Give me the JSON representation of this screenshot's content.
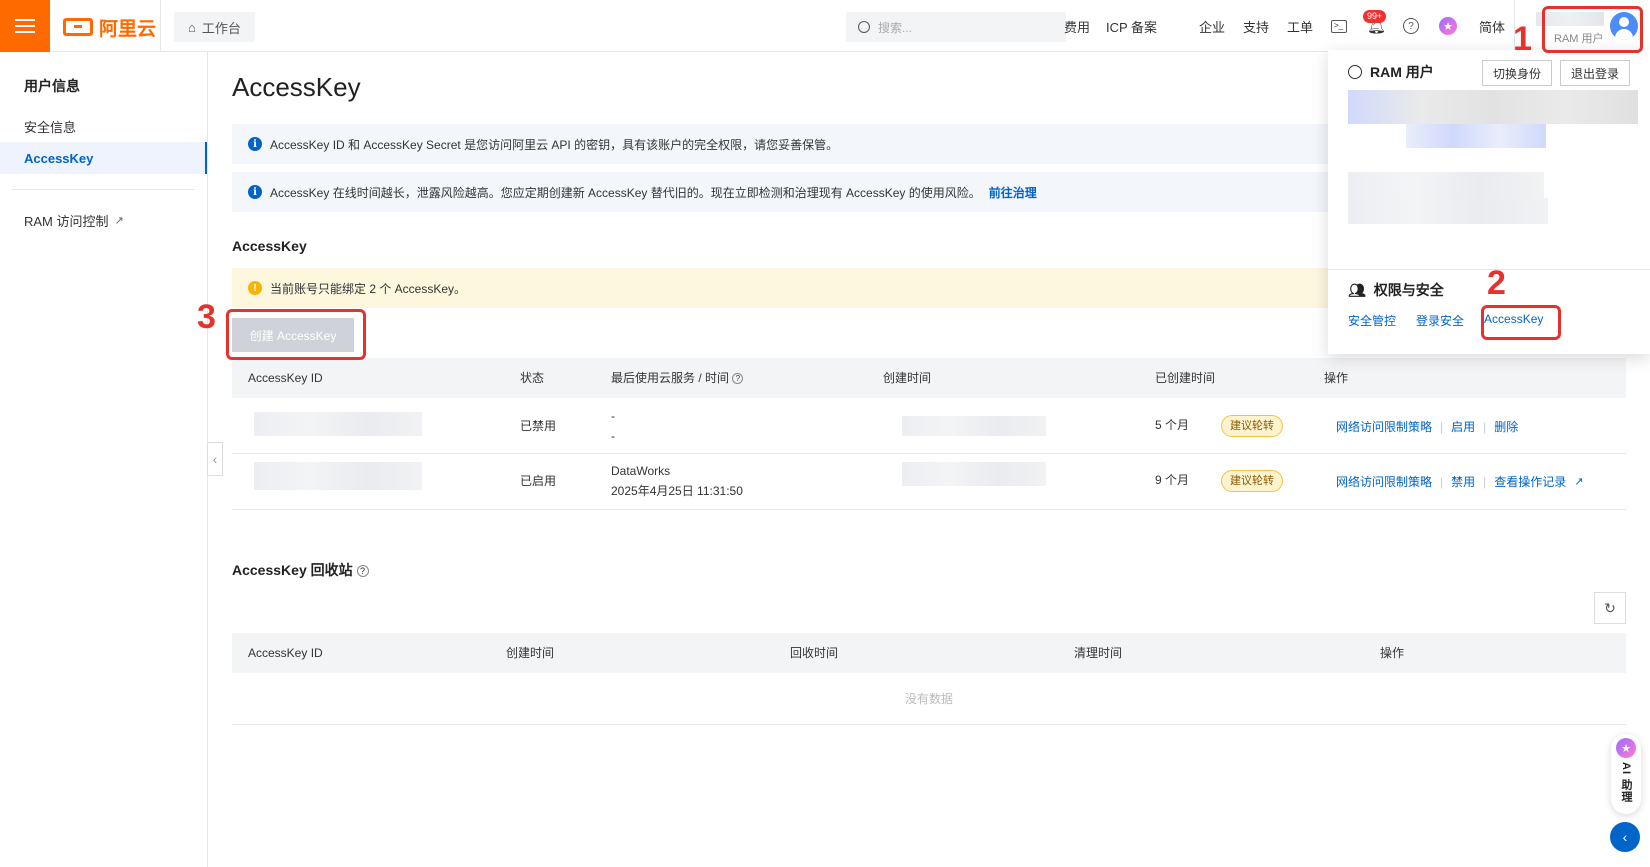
{
  "header": {
    "brand": "阿里云",
    "workbench": "工作台",
    "search_placeholder": "搜索...",
    "nav": [
      "费用",
      "ICP 备案",
      "企业",
      "支持",
      "工单"
    ],
    "notify_badge": "99+",
    "lang": "简体",
    "user_role": "RAM 用户"
  },
  "sidebar": {
    "title": "用户信息",
    "items": [
      {
        "label": "安全信息"
      },
      {
        "label": "AccessKey"
      },
      {
        "label": "RAM 访问控制"
      }
    ]
  },
  "main": {
    "title": "AccessKey",
    "notice1": "AccessKey ID 和 AccessKey Secret 是您访问阿里云 API 的密钥，具有该账户的完全权限，请您妥善保管。",
    "notice2": "AccessKey 在线时间越长，泄露风险越高。您应定期创建新 AccessKey 替代旧的。现在立即检测和治理现有 AccessKey 的使用风险。",
    "notice2_link": "前往治理",
    "section1": "AccessKey",
    "warning": "当前账号只能绑定 2 个 AccessKey。",
    "create_button": "创建 AccessKey",
    "table": {
      "columns": [
        "AccessKey ID",
        "状态",
        "最后使用云服务 / 时间",
        "创建时间",
        "已创建时间",
        "操作"
      ],
      "rows": [
        {
          "status": "已禁用",
          "service": "-",
          "time": "-",
          "age": "5 个月",
          "tag": "建议轮转",
          "ops": [
            "网络访问限制策略",
            "启用",
            "删除"
          ]
        },
        {
          "status": "已启用",
          "service": "DataWorks",
          "time": "2025年4月25日 11:31:50",
          "age": "9 个月",
          "tag": "建议轮转",
          "ops": [
            "网络访问限制策略",
            "禁用",
            "查看操作记录"
          ]
        }
      ]
    },
    "section2": "AccessKey 回收站",
    "recycle": {
      "columns": [
        "AccessKey ID",
        "创建时间",
        "回收时间",
        "清理时间",
        "操作"
      ],
      "empty": "没有数据"
    }
  },
  "dropdown": {
    "title": "RAM 用户",
    "switch_button": "切换身份",
    "logout_button": "退出登录",
    "perm_title": "权限与安全",
    "links": [
      "安全管控",
      "登录安全",
      "AccessKey"
    ]
  },
  "annotations": {
    "n1": "1",
    "n2": "2",
    "n3": "3"
  },
  "ai_assistant": "AI 助理"
}
